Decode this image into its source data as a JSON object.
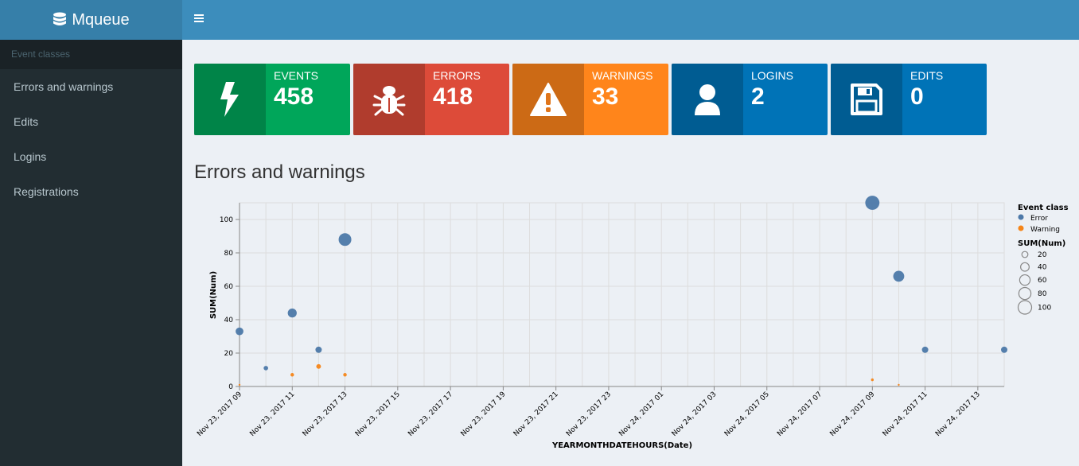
{
  "app": {
    "title": "Mqueue"
  },
  "sidebar": {
    "header": "Event classes",
    "items": [
      {
        "label": "Errors and warnings"
      },
      {
        "label": "Edits"
      },
      {
        "label": "Logins"
      },
      {
        "label": "Registrations"
      }
    ]
  },
  "info_boxes": [
    {
      "label": "EVENTS",
      "value": "458",
      "icon": "bolt-icon",
      "color": "#00a65a"
    },
    {
      "label": "ERRORS",
      "value": "418",
      "icon": "bug-icon",
      "color": "#dd4b39"
    },
    {
      "label": "WARNINGS",
      "value": "33",
      "icon": "warning-icon",
      "color": "#ff851b"
    },
    {
      "label": "LOGINS",
      "value": "2",
      "icon": "user-icon",
      "color": "#0073b7"
    },
    {
      "label": "EDITS",
      "value": "0",
      "icon": "save-icon",
      "color": "#0073b7"
    }
  ],
  "section": {
    "title": "Errors and warnings"
  },
  "chart_data": {
    "type": "scatter",
    "xlabel": "YEARMONTHDATEHOURS(Date)",
    "ylabel": "SUM(Num)",
    "ylim": [
      0,
      110
    ],
    "yticks": [
      0,
      20,
      40,
      60,
      80,
      100
    ],
    "xticks": [
      "Nov 23, 2017 09",
      "Nov 23, 2017 11",
      "Nov 23, 2017 13",
      "Nov 23, 2017 15",
      "Nov 23, 2017 17",
      "Nov 23, 2017 19",
      "Nov 23, 2017 21",
      "Nov 23, 2017 23",
      "Nov 24, 2017 01",
      "Nov 24, 2017 03",
      "Nov 24, 2017 05",
      "Nov 24, 2017 07",
      "Nov 24, 2017 09",
      "Nov 24, 2017 11",
      "Nov 24, 2017 13"
    ],
    "grid": true,
    "legend_position": "right",
    "legend": {
      "color_title": "Event class",
      "size_title": "SUM(Num)",
      "size_values": [
        20,
        40,
        60,
        80,
        100
      ]
    },
    "series": [
      {
        "name": "Error",
        "color": "#4c78a8",
        "points": [
          {
            "x": "Nov 23, 2017 09",
            "y": 33
          },
          {
            "x": "Nov 23, 2017 10",
            "y": 11
          },
          {
            "x": "Nov 23, 2017 11",
            "y": 44
          },
          {
            "x": "Nov 23, 2017 12",
            "y": 22
          },
          {
            "x": "Nov 23, 2017 13",
            "y": 88
          },
          {
            "x": "Nov 24, 2017 09",
            "y": 110
          },
          {
            "x": "Nov 24, 2017 10",
            "y": 66
          },
          {
            "x": "Nov 24, 2017 11",
            "y": 22
          },
          {
            "x": "Nov 24, 2017 14",
            "y": 22
          }
        ]
      },
      {
        "name": "Warning",
        "color": "#f58518",
        "points": [
          {
            "x": "Nov 23, 2017 09",
            "y": 1
          },
          {
            "x": "Nov 23, 2017 11",
            "y": 7
          },
          {
            "x": "Nov 23, 2017 12",
            "y": 12
          },
          {
            "x": "Nov 23, 2017 13",
            "y": 7
          },
          {
            "x": "Nov 24, 2017 09",
            "y": 4
          },
          {
            "x": "Nov 24, 2017 10",
            "y": 1
          }
        ]
      }
    ]
  }
}
